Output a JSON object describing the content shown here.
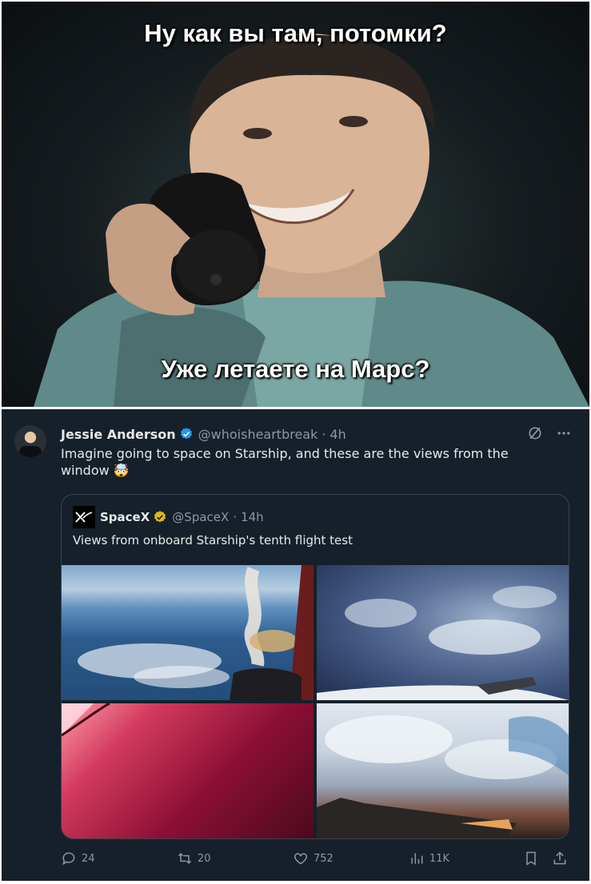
{
  "meme": {
    "top_caption": "Ну как вы там, потомки?",
    "bottom_caption": "Уже летаете на Марс?"
  },
  "tweet": {
    "author_name": "Jessie Anderson",
    "author_handle": "@whoisheartbreak",
    "time": "4h",
    "verified_color": "#1d9bf0",
    "text": "Imagine going to space on Starship, and these are the views from the window 🤯",
    "quote": {
      "author_name": "SpaceX",
      "author_handle": "@SpaceX",
      "time": "14h",
      "verified_color": "#e2b719",
      "text": "Views from onboard Starship's tenth flight test"
    },
    "actions": {
      "replies": "24",
      "reposts": "20",
      "likes": "752",
      "views": "11K"
    }
  },
  "icons": [
    "grok-icon",
    "more-icon",
    "reply-icon",
    "repost-icon",
    "like-icon",
    "views-icon",
    "bookmark-icon",
    "share-icon"
  ],
  "colors": {
    "background": "#15202b",
    "text": "#e7e9ea",
    "muted": "#8b98a5",
    "border": "#38444d"
  }
}
